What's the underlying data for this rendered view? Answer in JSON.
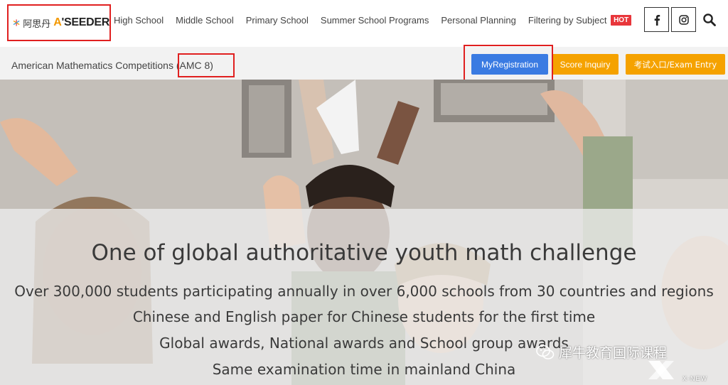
{
  "brand": {
    "name_cn": "阿思丹",
    "name_en": "A'SEEDER"
  },
  "nav": {
    "items": [
      {
        "label": "High School"
      },
      {
        "label": "Middle School"
      },
      {
        "label": "Primary School"
      },
      {
        "label": "Summer School Programs"
      },
      {
        "label": "Personal Planning"
      },
      {
        "label": "Filtering by Subject",
        "badge": "HOT"
      }
    ],
    "icons": [
      "facebook-icon",
      "instagram-icon",
      "search-icon"
    ]
  },
  "subheader": {
    "competition_title": "American Mathematics Competitions (AMC 8)",
    "buttons": {
      "registration": "MyRegistration",
      "score": "Score Inquiry",
      "exam": "考试入口/Exam Entry"
    }
  },
  "hero": {
    "title": "One of global authoritative youth math challenge",
    "lines": [
      "Over 300,000 students participating annually in over 6,000 schools from 30 countries and regions",
      "Chinese and English paper for Chinese students for the first time",
      "Global awards, National awards and School group awards",
      "Same examination time in mainland China"
    ]
  },
  "watermark": {
    "text": "犀牛教育国际课程",
    "sub": "X-NEW"
  },
  "colors": {
    "registration_button": "#3a7be2",
    "score_button": "#f5a200",
    "exam_button": "#f5a200",
    "hot_badge": "#e8363b",
    "highlight_box": "#e02020"
  }
}
